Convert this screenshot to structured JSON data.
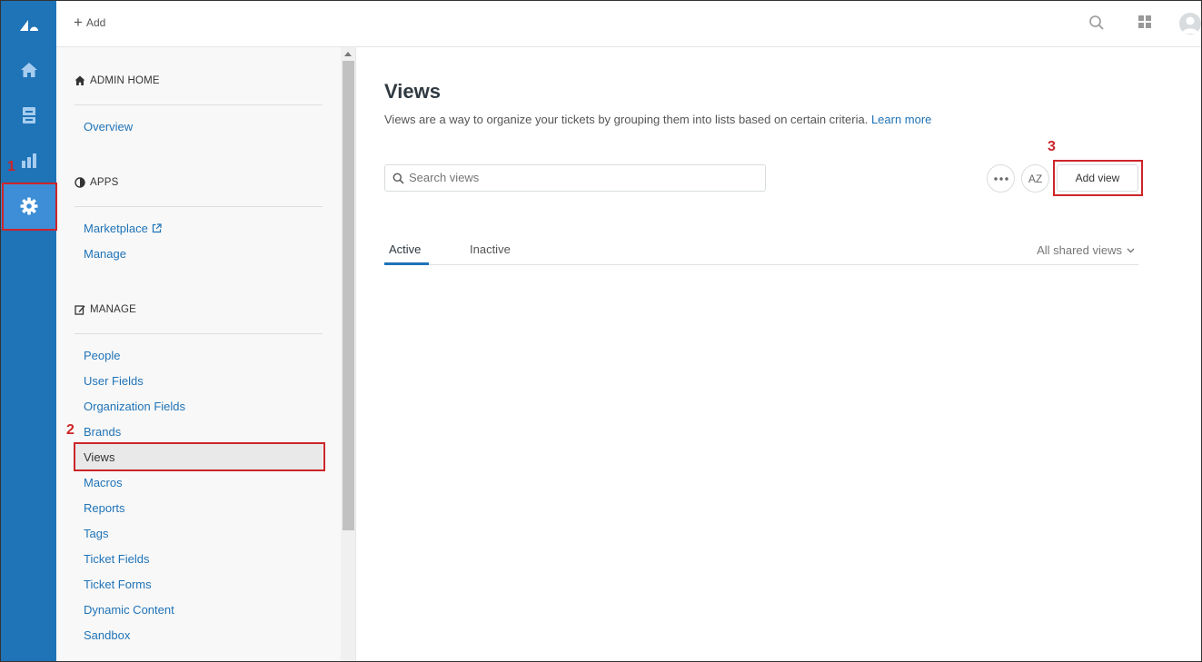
{
  "topbar": {
    "add_label": "Add"
  },
  "sidebar": {
    "sections": [
      {
        "title": "ADMIN HOME",
        "icon": "home-icon",
        "items": [
          "Overview"
        ]
      },
      {
        "title": "APPS",
        "icon": "half-circle-icon",
        "items": [
          "Marketplace",
          "Manage"
        ]
      },
      {
        "title": "MANAGE",
        "icon": "edit-icon",
        "items": [
          "People",
          "User Fields",
          "Organization Fields",
          "Brands",
          "Views",
          "Macros",
          "Reports",
          "Tags",
          "Ticket Fields",
          "Ticket Forms",
          "Dynamic Content",
          "Sandbox"
        ]
      }
    ],
    "active_item": "Views"
  },
  "main": {
    "title": "Views",
    "description": "Views are a way to organize your tickets by grouping them into lists based on certain criteria.",
    "learn_more": "Learn more",
    "search_placeholder": "Search views",
    "sort_label": "AZ",
    "add_view_label": "Add view",
    "tabs": [
      "Active",
      "Inactive"
    ],
    "filter_label": "All shared views"
  },
  "callouts": [
    "1",
    "2",
    "3"
  ],
  "colors": {
    "brand_blue": "#1f73b7",
    "rail_active": "#3d8ed6",
    "callout_red": "#cc2529"
  }
}
